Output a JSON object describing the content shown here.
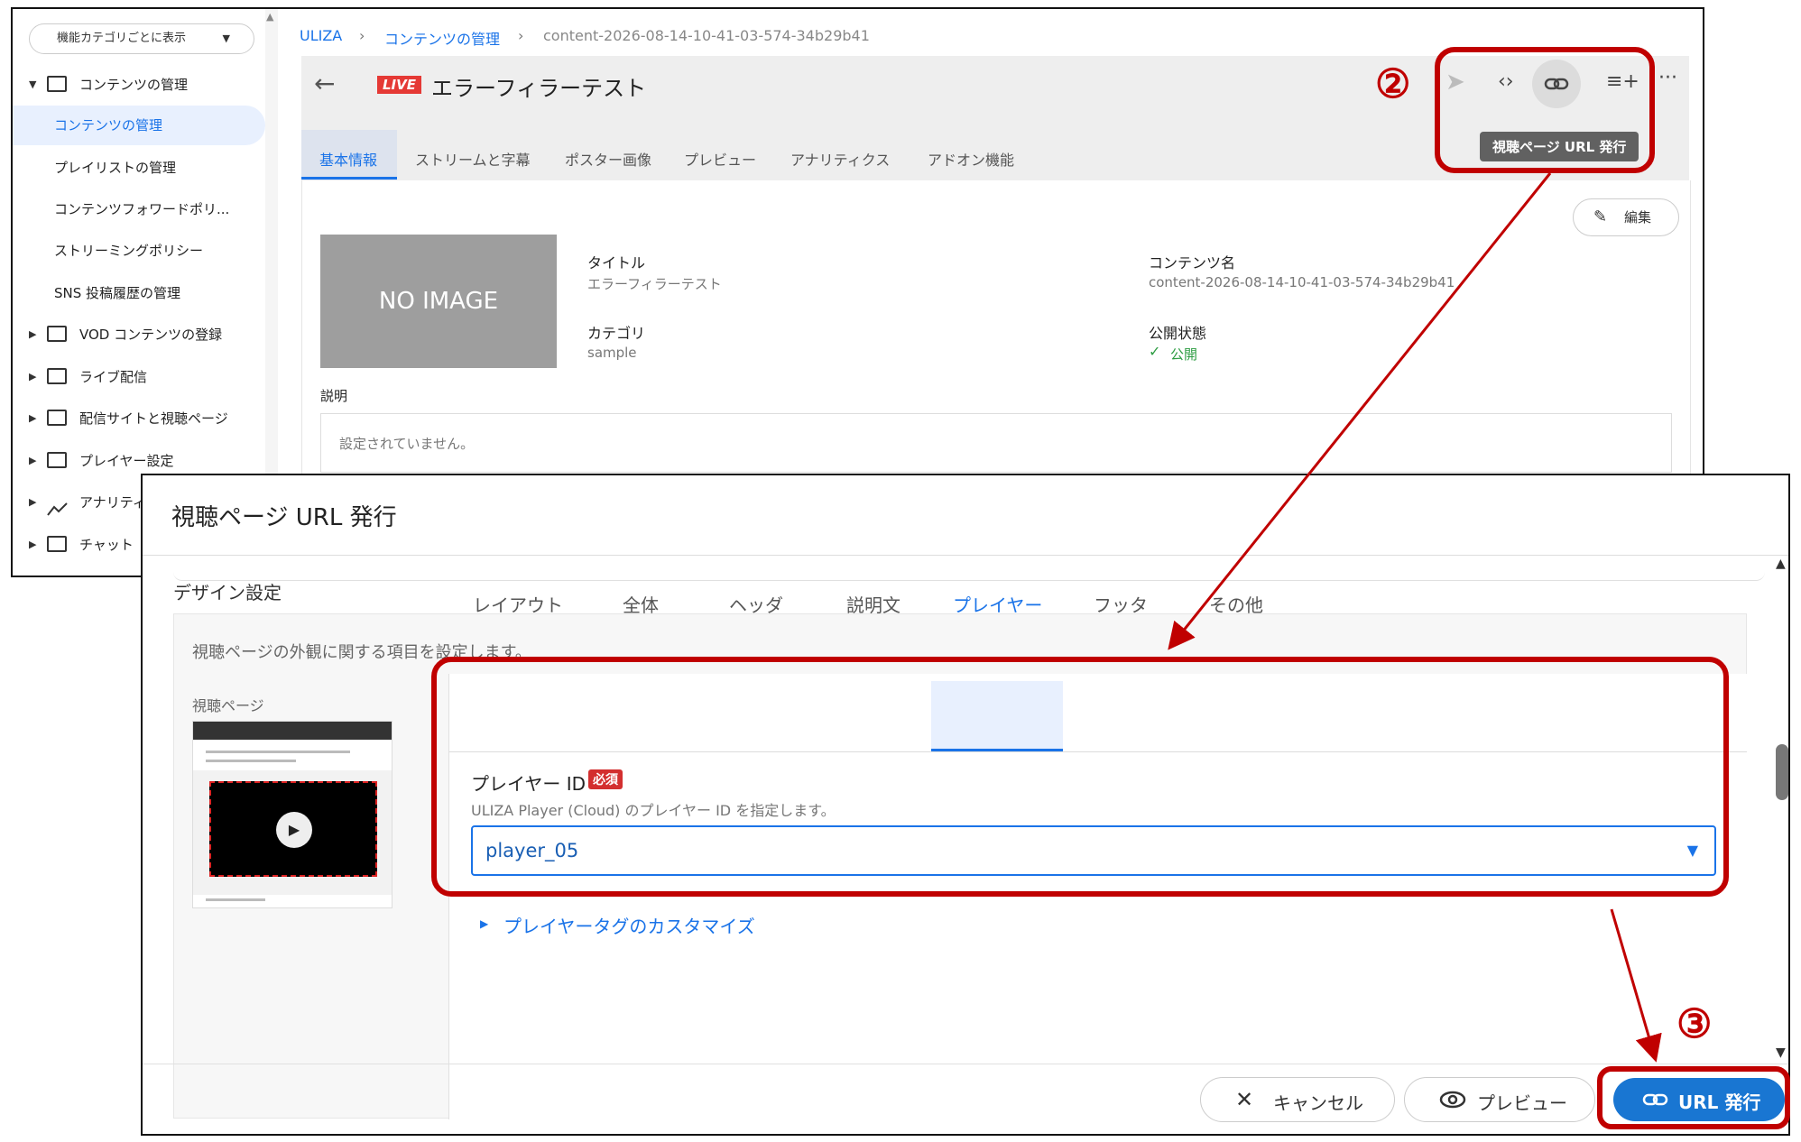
{
  "sidebar": {
    "view_mode": "機能カテゴリごとに表示",
    "section_title": "コンテンツの管理",
    "items": [
      {
        "label": "コンテンツの管理"
      },
      {
        "label": "プレイリストの管理"
      },
      {
        "label": "コンテンツフォワードポリ..."
      },
      {
        "label": "ストリーミングポリシー"
      },
      {
        "label": "SNS 投稿履歴の管理"
      }
    ],
    "groups": [
      {
        "label": "VOD コンテンツの登録"
      },
      {
        "label": "ライブ配信"
      },
      {
        "label": "配信サイトと視聴ページ"
      },
      {
        "label": "プレイヤー設定"
      },
      {
        "label": "アナリティ"
      },
      {
        "label": "チャット"
      }
    ]
  },
  "breadcrumb": {
    "root": "ULIZA",
    "section": "コンテンツの管理",
    "current": "content-2026-08-14-10-41-03-574-34b29b41"
  },
  "content": {
    "live_badge": "LIVE",
    "title": "エラーフィラーテスト",
    "tooltip": "視聴ページ URL 発行",
    "tabs": [
      "基本情報",
      "ストリームと字幕",
      "ポスター画像",
      "プレビュー",
      "アナリティクス",
      "アドオン機能"
    ],
    "edit_label": "編集",
    "no_image": "NO IMAGE",
    "fields": {
      "title_label": "タイトル",
      "title_value": "エラーフィラーテスト",
      "content_name_label": "コンテンツ名",
      "content_name_value": "content-2026-08-14-10-41-03-574-34b29b41",
      "category_label": "カテゴリ",
      "category_value": "sample",
      "status_label": "公開状態",
      "status_value": "公開",
      "description_label": "説明",
      "description_value": "設定されていません。"
    }
  },
  "dialog": {
    "title": "視聴ページ URL 発行",
    "section_title": "デザイン設定",
    "section_desc": "視聴ページの外観に関する項目を設定します。",
    "preview_label": "視聴ページ",
    "tabs": [
      "レイアウト",
      "全体",
      "ヘッダ",
      "説明文",
      "プレイヤー",
      "フッタ",
      "その他"
    ],
    "active_tab": "プレイヤー",
    "player_id_label": "プレイヤー ID",
    "required_badge": "必須",
    "player_id_help": "ULIZA Player (Cloud) のプレイヤー ID を指定します。",
    "player_id_value": "player_05",
    "customize_link": "プレイヤータグのカスタマイズ",
    "cancel_label": "キャンセル",
    "preview_button_label": "プレビュー",
    "issue_url_label": "URL 発行"
  },
  "annotations": {
    "step2": "②",
    "step3": "③"
  },
  "colors": {
    "accent": "#1a73e8",
    "primary_button": "#1976d2",
    "annotation_red": "#c00000",
    "live_red": "#e53935",
    "status_green": "#2e9d43"
  }
}
